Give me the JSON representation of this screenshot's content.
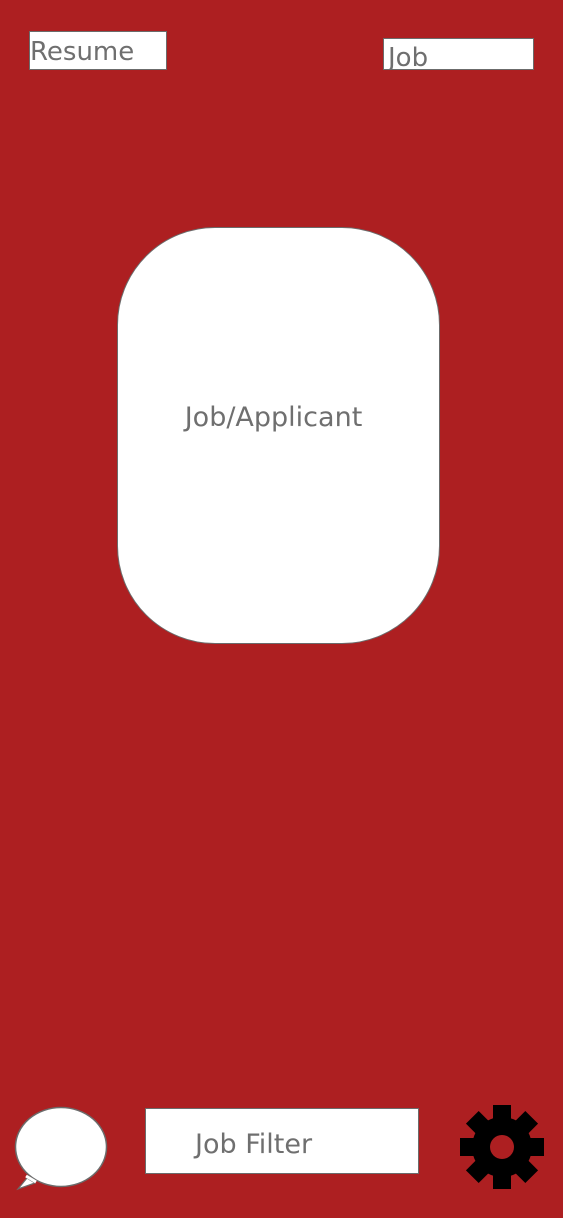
{
  "app": {
    "background_color": "#ad1f21",
    "surface_color": "#ffffff",
    "text_color": "#6f6f6f"
  },
  "header": {
    "resume_label": "Resume",
    "job_label": "Job"
  },
  "card": {
    "label": "Job/Applicant"
  },
  "footer": {
    "chat_icon": "chat-bubble-icon",
    "filter_label": "Job Filter",
    "settings_icon": "gear-icon"
  }
}
